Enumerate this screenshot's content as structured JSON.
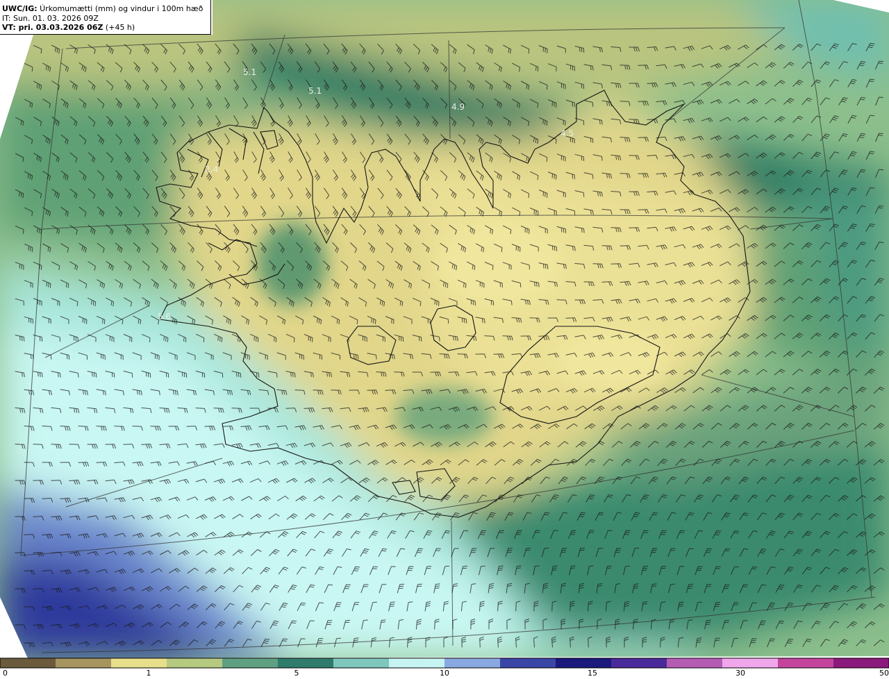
{
  "header": {
    "model_label": "UWC/IG:",
    "title_rest": " Úrkomumætti (mm) og vindur i 100m hæð",
    "init_line": "IT: Sun. 01. 03. 2026 09Z",
    "valid_bold": "VT: pri. 03.03.2026 06Z",
    "valid_rest": " (+45 h)"
  },
  "colorbar": {
    "ticks": [
      "0",
      "1",
      "5",
      "10",
      "15",
      "30",
      "50"
    ],
    "colors": [
      "#6b5a3c",
      "#a6955f",
      "#e8df8c",
      "#b6c980",
      "#5fa082",
      "#2f7c6c",
      "#7fc6bd",
      "#c6f4f2",
      "#8aa8e0",
      "#3a46a6",
      "#1a1a7c",
      "#4a2a9a",
      "#b45cb4",
      "#f0a6ea",
      "#c4449c",
      "#8a1a7c"
    ]
  },
  "map_labels": [
    "5.1",
    "5.1",
    "4.9",
    "4.5",
    "2.4",
    "5.6"
  ],
  "colors": {
    "land_yellow": "#e9dd8c",
    "sea_green": "#2f7f6a",
    "sea_teal": "#7ecbb9",
    "sea_cyan": "#c5f6f3",
    "sea_blue": "#2c3aa0",
    "coast": "#1a1a1a"
  }
}
